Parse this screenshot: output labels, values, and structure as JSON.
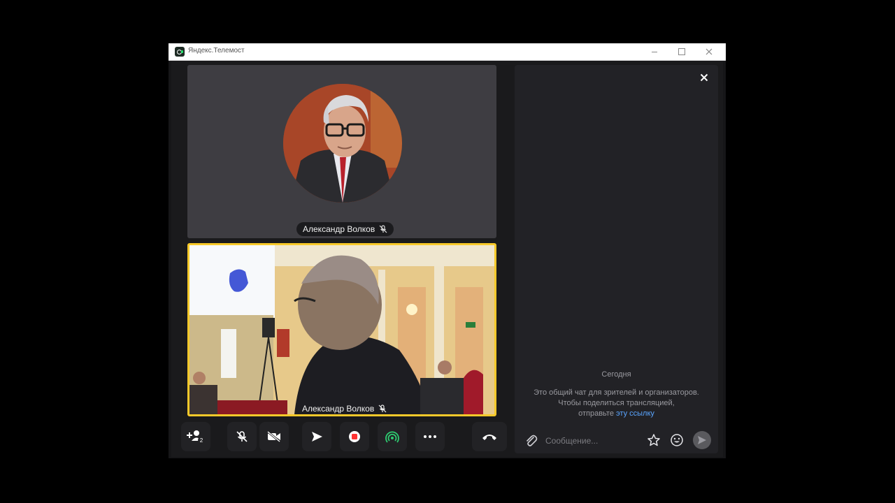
{
  "window": {
    "title": "Яндекс.Телемост"
  },
  "participants": [
    {
      "name": "Александр Волков",
      "muted": true,
      "video": false
    },
    {
      "name": "Александр Волков",
      "muted": true,
      "video": true,
      "active_speaker": true
    }
  ],
  "controls": {
    "invite_badge_count": "2",
    "icons": [
      "add-participant-icon",
      "mic-off-icon",
      "camera-off-icon",
      "share-screen-icon",
      "record-icon",
      "broadcast-icon",
      "more-icon",
      "hang-up-icon"
    ],
    "accent_record": "#ff3333",
    "accent_broadcast": "#2ecc71",
    "accent_active": "#f7c92a"
  },
  "chat": {
    "date_label": "Сегодня",
    "info_line1": "Это общий чат для зрителей и организаторов.",
    "info_line2": "Чтобы поделиться трансляцией,",
    "info_line3_prefix": "отправьте ",
    "info_link": "эту ссылку",
    "input_placeholder": "Сообщение..."
  }
}
